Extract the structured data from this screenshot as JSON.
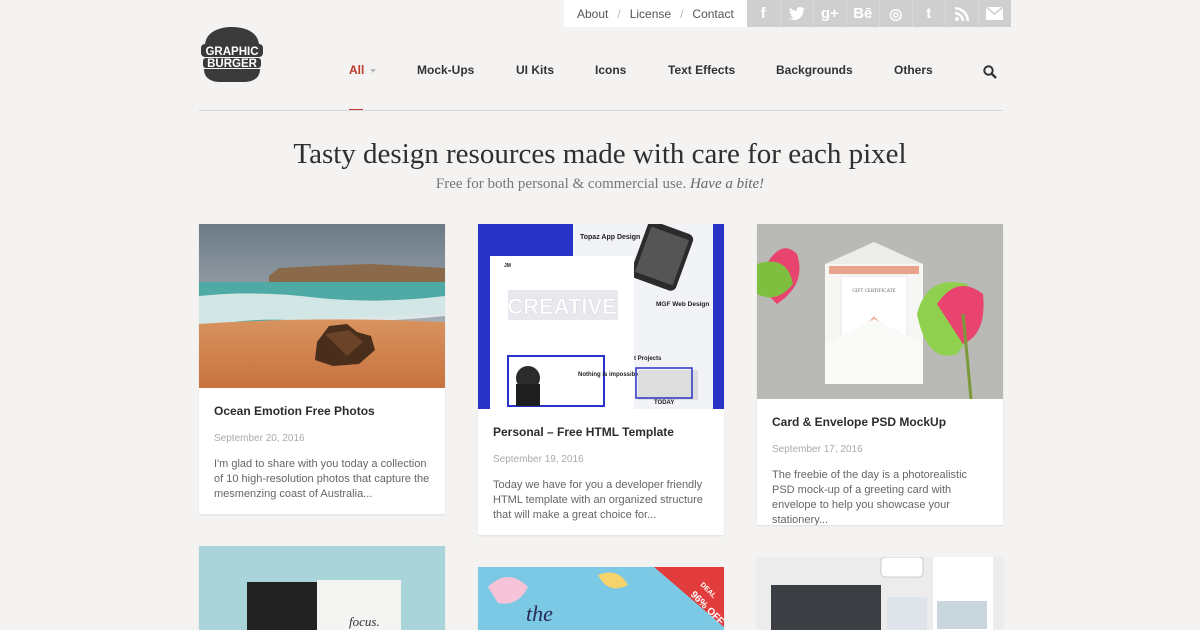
{
  "top_links": [
    "About",
    "License",
    "Contact"
  ],
  "social_icons": [
    {
      "name": "facebook-icon",
      "glyph": "f"
    },
    {
      "name": "twitter-icon",
      "glyph": "t"
    },
    {
      "name": "google-plus-icon",
      "glyph": "g+"
    },
    {
      "name": "behance-icon",
      "glyph": "Bē"
    },
    {
      "name": "dribbble-icon",
      "glyph": "◎"
    },
    {
      "name": "tumblr-icon",
      "glyph": "t"
    },
    {
      "name": "rss-icon",
      "glyph": "◝"
    },
    {
      "name": "email-icon",
      "glyph": "✉"
    }
  ],
  "logo": {
    "line1": "GRAPHIC",
    "line2": "BURGER"
  },
  "nav": [
    "All",
    "Mock-Ups",
    "UI Kits",
    "Icons",
    "Text Effects",
    "Backgrounds",
    "Others"
  ],
  "hero": {
    "title": "Tasty design resources made with care for each pixel",
    "subtitle": "Free for both personal & commercial use.",
    "subtitle_em": "Have a bite!"
  },
  "cards": [
    {
      "title": "Ocean Emotion Free Photos",
      "date": "September 20, 2016",
      "desc": "I'm glad to share with you today a collection of 10 high-resolution photos that capture the mesmenzing coast of Australia..."
    },
    {
      "title": "Personal – Free HTML Template",
      "date": "September 19, 2016",
      "desc": "Today we have for you a developer friendly HTML template with an organized structure that will make a great choice for..."
    },
    {
      "title": "Card & Envelope PSD MockUp",
      "date": "September 17, 2016",
      "desc": "The freebie of the day is a photorealistic PSD mock-up of a greeting card with envelope to help you showcase your stationery..."
    }
  ],
  "thumb_text": {
    "topaz": "Topaz App Design",
    "creative": "CREATIVE",
    "jm": "JM",
    "mgf": "MGF Web Design",
    "projects": "t Projects",
    "impossible": "Nothing is impossible",
    "today": "TODAY",
    "gift": "GIFT CERTIFICATE",
    "focus": "focus.",
    "deal": "DEAL",
    "discount": "96% OFF",
    "the": "the"
  },
  "colors": {
    "accent": "#c0392b",
    "social_bg": "#cfcfcf",
    "page_bg": "#f4f3f1"
  }
}
